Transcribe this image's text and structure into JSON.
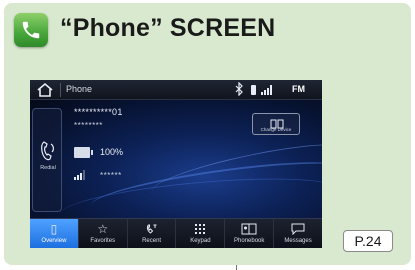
{
  "page": {
    "title": "“Phone” SCREEN",
    "reference": "P.24"
  },
  "statusbar": {
    "title": "Phone",
    "bluetooth_icon": "bluetooth-icon",
    "source": "FM"
  },
  "device": {
    "number": "**********01",
    "name": "********",
    "battery_percent": "100%",
    "battery_level": 1.0,
    "carrier": "******",
    "signal_bars": 3
  },
  "side": {
    "redial_label": "Redial"
  },
  "change_device": {
    "label": "Change Device"
  },
  "tabs": [
    {
      "label": "Overview",
      "icon": "phone-outline-icon",
      "active": true
    },
    {
      "label": "Favorites",
      "icon": "star-icon",
      "active": false
    },
    {
      "label": "Recent",
      "icon": "recent-calls-icon",
      "active": false
    },
    {
      "label": "Keypad",
      "icon": "keypad-icon",
      "active": false
    },
    {
      "label": "Phonebook",
      "icon": "phonebook-icon",
      "active": false
    },
    {
      "label": "Messages",
      "icon": "messages-icon",
      "active": false
    }
  ],
  "colors": {
    "panel_background": "#d9e9cf",
    "active_tab": "#2f86f0",
    "screen_background": "#050a18"
  }
}
